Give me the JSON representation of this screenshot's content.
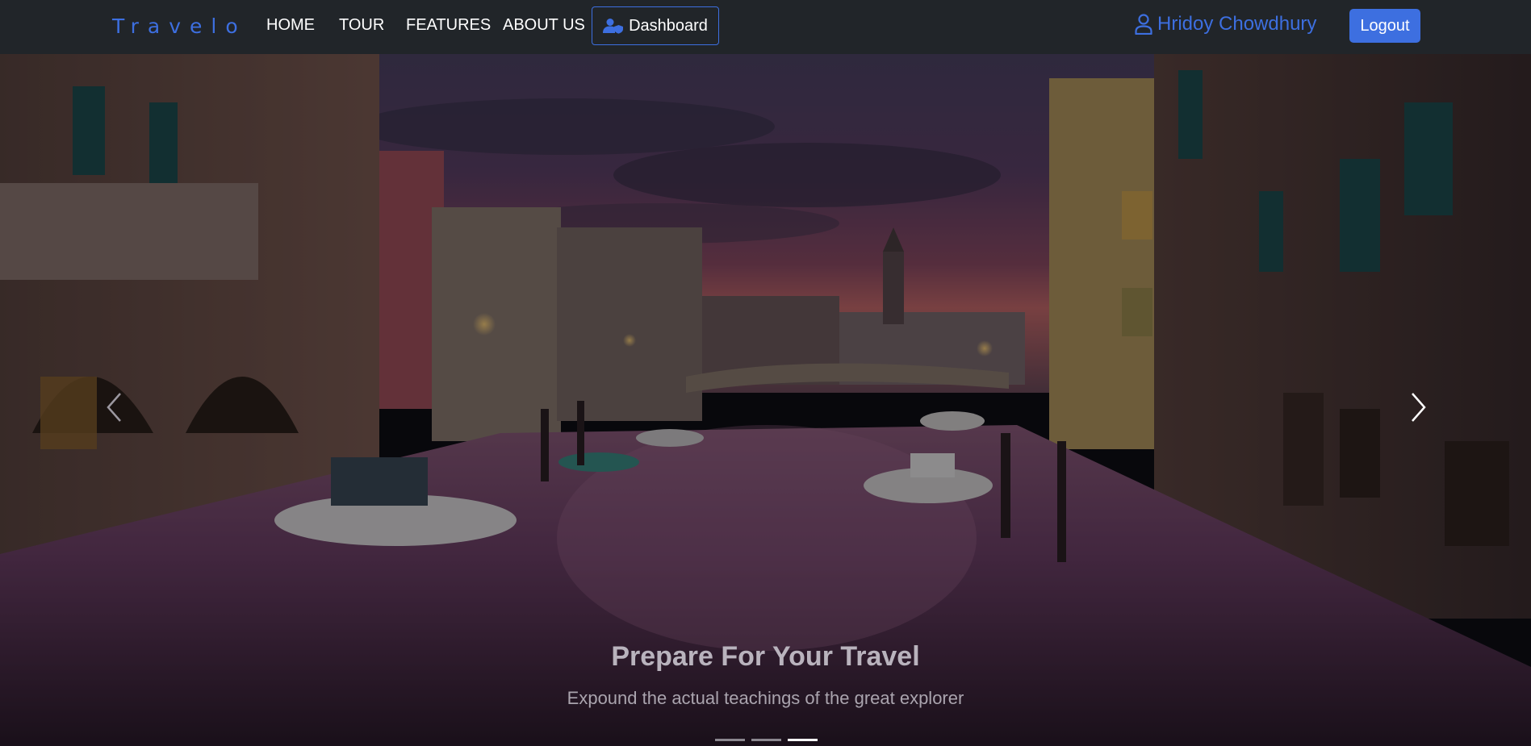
{
  "navbar": {
    "brand": "Travelo",
    "links": [
      "HOME",
      "TOUR",
      "FEATURES",
      "ABOUT US"
    ],
    "dashboard_label": "Dashboard",
    "dashboard_icon": "user-shield-icon",
    "user_icon": "user-icon",
    "user_name": "Hridoy Chowdhury",
    "logout_label": "Logout",
    "colors": {
      "background": "#212529",
      "accent": "#3d6fe0",
      "text": "#ffffff"
    }
  },
  "carousel": {
    "caption_title": "Prepare For Your Travel",
    "caption_subtitle": "Expound the actual teachings of the great explorer",
    "prev_icon": "chevron-left-icon",
    "next_icon": "chevron-right-icon",
    "slide_count": 3,
    "active_slide": 3
  }
}
